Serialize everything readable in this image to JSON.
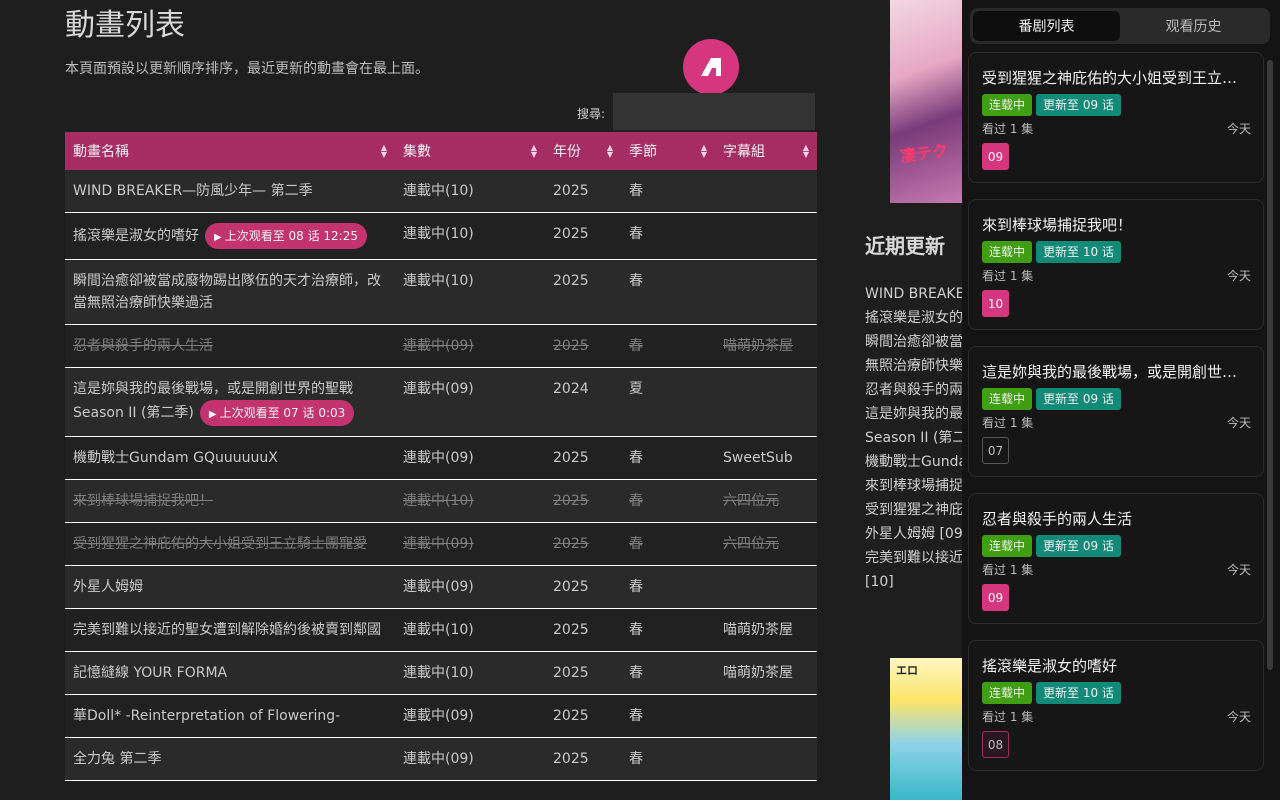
{
  "page": {
    "title": "動畫列表",
    "description": "本頁面預設以更新順序排序，最近更新的動畫會在最上面。",
    "search_label": "搜尋:",
    "search_value": ""
  },
  "table": {
    "headers": [
      "動畫名稱",
      "集數",
      "年份",
      "季節",
      "字幕組"
    ],
    "rows": [
      {
        "name": "WIND BREAKER—防風少年— 第二季",
        "resume": "",
        "episodes": "連載中(10)",
        "year": "2025",
        "season": "春",
        "group": "",
        "dim": false
      },
      {
        "name": "搖滾樂是淑女的嗜好",
        "resume": "上次观看至 08 话 12:25",
        "episodes": "連載中(10)",
        "year": "2025",
        "season": "春",
        "group": "",
        "dim": false
      },
      {
        "name": "瞬間治癒卻被當成廢物踢出隊伍的天才治療師，改當無照治療師快樂過活",
        "resume": "",
        "episodes": "連載中(10)",
        "year": "2025",
        "season": "春",
        "group": "",
        "dim": false
      },
      {
        "name": "忍者與殺手的兩人生活",
        "resume": "",
        "episodes": "連載中(09)",
        "year": "2025",
        "season": "春",
        "group": "喵萌奶茶屋",
        "dim": true
      },
      {
        "name": "這是妳與我的最後戰場，或是開創世界的聖戰 Season II (第二季)",
        "resume": "上次观看至 07 话 0:03",
        "episodes": "連載中(09)",
        "year": "2024",
        "season": "夏",
        "group": "",
        "dim": false
      },
      {
        "name": "機動戰士Gundam GQuuuuuuX",
        "resume": "",
        "episodes": "連載中(09)",
        "year": "2025",
        "season": "春",
        "group": "SweetSub",
        "dim": false
      },
      {
        "name": "來到棒球場捕捉我吧！",
        "resume": "",
        "episodes": "連載中(10)",
        "year": "2025",
        "season": "春",
        "group": "六四位元",
        "dim": true
      },
      {
        "name": "受到猩猩之神庇佑的大小姐受到王立騎士團寵愛",
        "resume": "",
        "episodes": "連載中(09)",
        "year": "2025",
        "season": "春",
        "group": "六四位元",
        "dim": true
      },
      {
        "name": "外星人姆姆",
        "resume": "",
        "episodes": "連載中(09)",
        "year": "2025",
        "season": "春",
        "group": "",
        "dim": false
      },
      {
        "name": "完美到難以接近的聖女遭到解除婚約後被賣到鄰國",
        "resume": "",
        "episodes": "連載中(10)",
        "year": "2025",
        "season": "春",
        "group": "喵萌奶茶屋",
        "dim": false
      },
      {
        "name": "記憶縫線 YOUR FORMA",
        "resume": "",
        "episodes": "連載中(10)",
        "year": "2025",
        "season": "春",
        "group": "喵萌奶茶屋",
        "dim": false
      },
      {
        "name": "華Doll* -Reinterpretation of Flowering-",
        "resume": "",
        "episodes": "連載中(09)",
        "year": "2025",
        "season": "春",
        "group": "",
        "dim": false
      },
      {
        "name": "全力兔 第二季",
        "resume": "",
        "episodes": "連載中(09)",
        "year": "2025",
        "season": "春",
        "group": "",
        "dim": false
      }
    ]
  },
  "recent": {
    "title": "近期更新",
    "items": [
      "WIND BREAKE",
      "搖滾樂是淑女的",
      "瞬間治癒卻被當",
      "無照治療師快樂",
      "忍者與殺手的兩",
      "這是妳與我的最",
      "Season II (第二",
      "機動戰士Gundam",
      "來到棒球場捕捉",
      "受到猩猩之神庇",
      "外星人姆姆 [09",
      "完美到難以接近",
      "[10]"
    ]
  },
  "banners": {
    "top_text": "凄テク",
    "bottom_text": "エロ"
  },
  "panel": {
    "tabs": [
      "番剧列表",
      "观看历史"
    ],
    "active_tab": 0,
    "cards": [
      {
        "title": "受到猩猩之神庇佑的大小姐受到王立騎士團寵愛",
        "status": "连载中",
        "update": "更新至 09 话",
        "watched": "看过 1 集",
        "when": "今天",
        "episode": "09",
        "ep_state": "new"
      },
      {
        "title": "來到棒球場捕捉我吧！",
        "status": "连载中",
        "update": "更新至 10 话",
        "watched": "看过 1 集",
        "when": "今天",
        "episode": "10",
        "ep_state": "new"
      },
      {
        "title": "這是妳與我的最後戰場，或是開創世界的聖戰",
        "status": "连载中",
        "update": "更新至 09 话",
        "watched": "看过 1 集",
        "when": "今天",
        "episode": "07",
        "ep_state": "seen"
      },
      {
        "title": "忍者與殺手的兩人生活",
        "status": "连载中",
        "update": "更新至 09 话",
        "watched": "看过 1 集",
        "when": "今天",
        "episode": "09",
        "ep_state": "new"
      },
      {
        "title": "搖滾樂是淑女的嗜好",
        "status": "连载中",
        "update": "更新至 10 话",
        "watched": "看过 1 集",
        "when": "今天",
        "episode": "08",
        "ep_state": "half"
      }
    ]
  },
  "colors": {
    "accent": "#d6367e",
    "header": "#a62c64",
    "status_green": "#3f9e12",
    "update_teal": "#128a78"
  }
}
